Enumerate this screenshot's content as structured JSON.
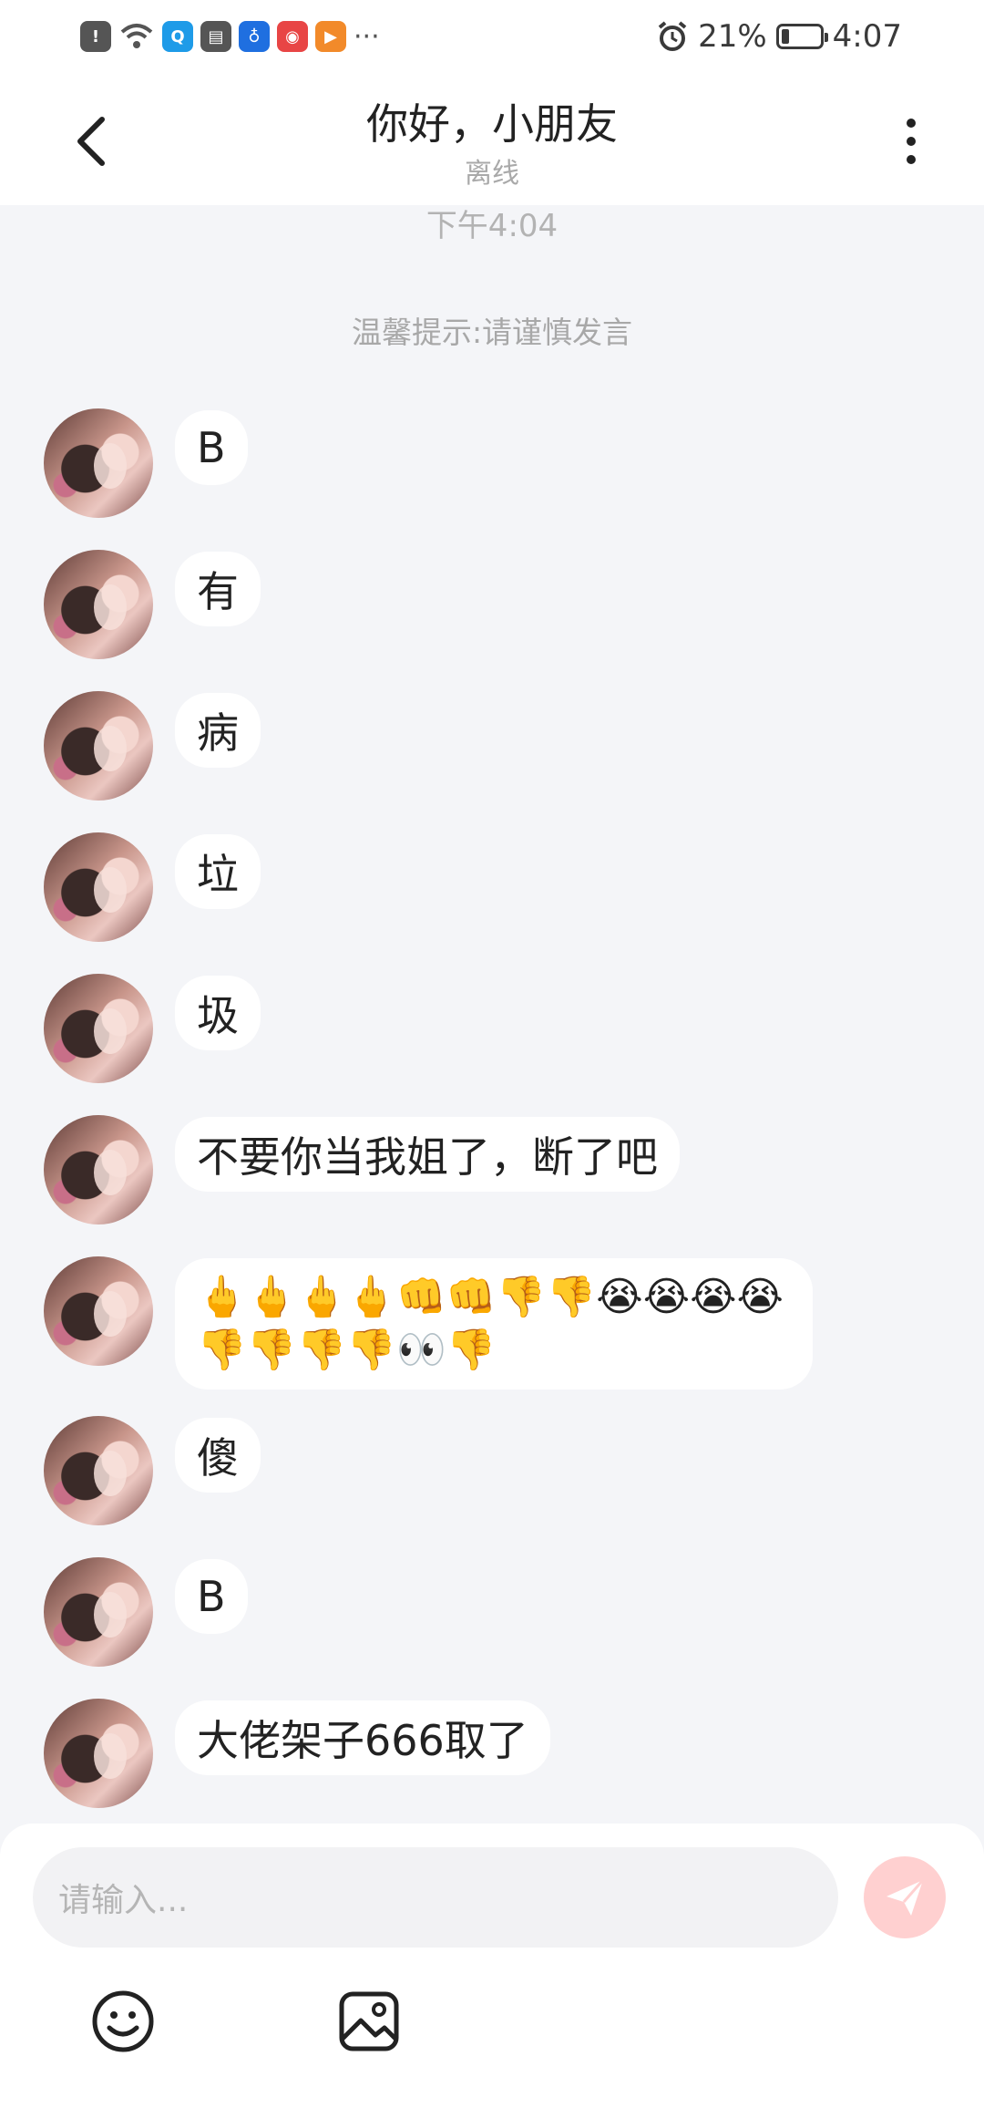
{
  "status_bar": {
    "battery_text": "21%",
    "battery_level": 0.21,
    "time": "4:07",
    "notif_icons": [
      "alert-icon",
      "wifi-icon",
      "search-app-icon",
      "calendar-icon",
      "bulb-app-icon",
      "game-app-icon",
      "video-app-icon"
    ],
    "more": "···"
  },
  "header": {
    "title": "你好，小朋友",
    "subtitle": "离线"
  },
  "chat": {
    "timestamp": "下午4:04",
    "tip": "温馨提示:请谨慎发言",
    "messages": [
      {
        "text": "B"
      },
      {
        "text": "有"
      },
      {
        "text": "病"
      },
      {
        "text": "垃"
      },
      {
        "text": "圾"
      },
      {
        "text": "不要你当我姐了，断了吧"
      },
      {
        "text": "🖕🖕🖕🖕👊👊👎👎😭😭😭😭👎👎👎👎👀👎"
      },
      {
        "text": "傻"
      },
      {
        "text": "B"
      },
      {
        "text": "大佬架子666取了"
      }
    ]
  },
  "input": {
    "placeholder": "请输入..."
  },
  "colors": {
    "background": "#f4f5f8",
    "bubble": "#ffffff",
    "send_button": "#ffd0d0"
  }
}
